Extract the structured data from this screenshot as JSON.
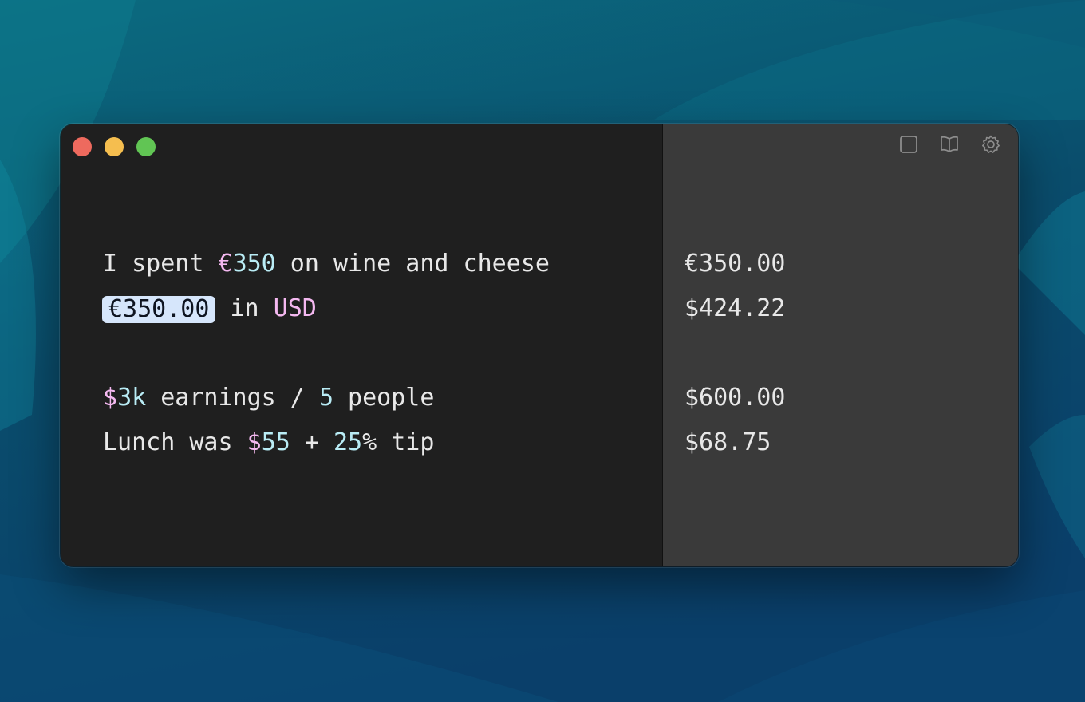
{
  "window": {
    "controls": [
      "close",
      "minimize",
      "zoom"
    ],
    "toolbar": [
      {
        "icon": "sidebar-icon"
      },
      {
        "icon": "book-icon"
      },
      {
        "icon": "gear-icon"
      }
    ]
  },
  "editor": {
    "lines": [
      {
        "segments": [
          {
            "text": "I spent ",
            "style": "plain"
          },
          {
            "text": "€",
            "style": "pink"
          },
          {
            "text": "350",
            "style": "cyan"
          },
          {
            "text": " on wine and cheese",
            "style": "plain"
          }
        ]
      },
      {
        "segments": [
          {
            "text": "€350.00",
            "style": "chip"
          },
          {
            "text": " in ",
            "style": "plain"
          },
          {
            "text": "USD",
            "style": "pink"
          }
        ]
      },
      {
        "segments": [
          {
            "text": "$",
            "style": "pink"
          },
          {
            "text": "3k",
            "style": "cyan"
          },
          {
            "text": " earnings / ",
            "style": "plain"
          },
          {
            "text": "5",
            "style": "cyan"
          },
          {
            "text": " people",
            "style": "plain"
          }
        ]
      },
      {
        "segments": [
          {
            "text": "Lunch was ",
            "style": "plain"
          },
          {
            "text": "$",
            "style": "pink"
          },
          {
            "text": "55",
            "style": "cyan"
          },
          {
            "text": " + ",
            "style": "plain"
          },
          {
            "text": "25",
            "style": "cyan"
          },
          {
            "text": "% tip",
            "style": "plain"
          }
        ]
      }
    ]
  },
  "results": [
    "€350.00",
    "$424.22",
    "$600.00",
    "$68.75"
  ],
  "colors": {
    "editor_bg": "#1f1f1f",
    "results_bg": "#3a3a3a",
    "text": "#e8e8e8",
    "currency_pink": "#f4b8f0",
    "number_cyan": "#b9ecf5",
    "chip_bg": "#d6e6fb",
    "close": "#ee6a5e",
    "minimize": "#f5be4f",
    "zoom": "#61c554"
  }
}
